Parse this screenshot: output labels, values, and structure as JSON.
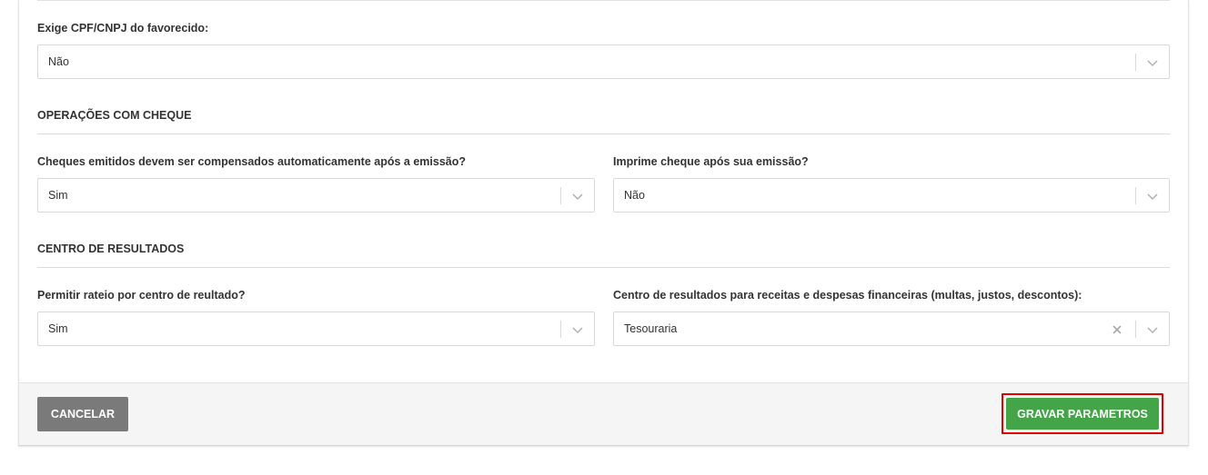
{
  "fields": {
    "favorecido": {
      "label": "Exige CPF/CNPJ do favorecido:",
      "value": "Não"
    },
    "cheques_compensados": {
      "label": "Cheques emitidos devem ser compensados automaticamente após a emissão?",
      "value": "Sim"
    },
    "imprime_cheque": {
      "label": "Imprime cheque após sua emissão?",
      "value": "Não"
    },
    "rateio": {
      "label": "Permitir rateio por centro de reultado?",
      "value": "Sim"
    },
    "centro_resultados": {
      "label": "Centro de resultados para receitas e despesas financeiras (multas, justos, descontos):",
      "value": "Tesouraria"
    }
  },
  "sections": {
    "cheque": "OPERAÇÕES COM CHEQUE",
    "resultados": "CENTRO DE RESULTADOS"
  },
  "footer": {
    "cancel_label": "CANCELAR",
    "save_label": "GRAVAR PARAMETROS"
  },
  "colors": {
    "save_button": "#43a547",
    "cancel_button": "#7a7a7a",
    "highlight_outline": "#e00000"
  },
  "icons": {
    "dropdown": "chevron-down-icon",
    "clear": "close-icon"
  }
}
